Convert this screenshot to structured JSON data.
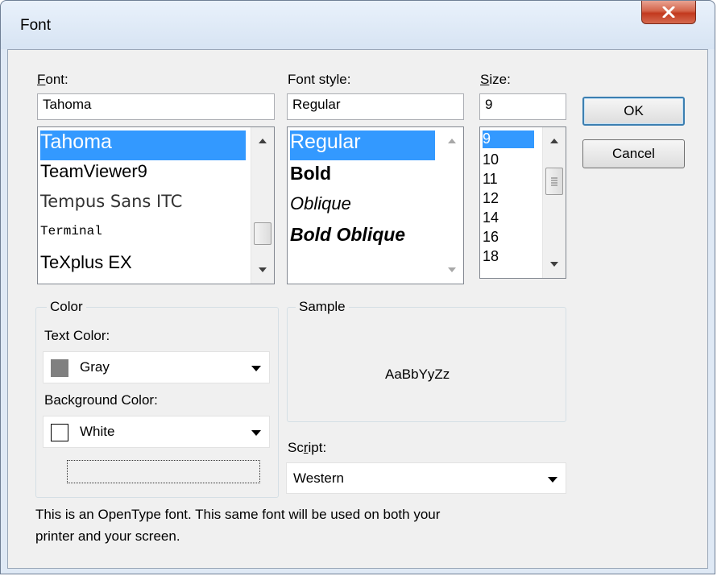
{
  "window": {
    "title": "Font",
    "close_glyph": "x"
  },
  "font": {
    "label_prefix": "F",
    "label_rest": "ont:",
    "value": "Tahoma",
    "items": [
      "Tahoma",
      "TeamViewer9",
      "Tempus Sans ITC",
      "Terminal",
      "TeXplus EX"
    ],
    "selected": "Tahoma"
  },
  "font_style": {
    "label": "Font style:",
    "value": "Regular",
    "items": [
      "Regular",
      "Bold",
      "Oblique",
      "Bold Oblique"
    ],
    "selected": "Regular"
  },
  "size": {
    "label_prefix": "S",
    "label_rest": "ize:",
    "value": "9",
    "items": [
      "9",
      "10",
      "11",
      "12",
      "14",
      "16",
      "18"
    ],
    "selected": "9"
  },
  "buttons": {
    "ok": "OK",
    "cancel": "Cancel"
  },
  "color_group": {
    "title": "Color",
    "text_color_label": "Text Color:",
    "text_color_value": "Gray",
    "text_color_swatch": "#808080",
    "bg_color_label": "Background Color:",
    "bg_color_value": "White",
    "bg_color_swatch": "#ffffff"
  },
  "sample": {
    "title": "Sample",
    "text": "AaBbYyZz"
  },
  "script": {
    "label_prefix": "Sc",
    "label_u": "r",
    "label_rest": "ipt:",
    "value": "Western"
  },
  "description": {
    "line1": "This is an OpenType font. This same font will be used on both your",
    "line2": "printer and your screen."
  },
  "icons": {
    "close": "close-icon",
    "scroll_up": "chevron-up-icon",
    "scroll_down": "chevron-down-icon",
    "dropdown": "dropdown-arrow-icon"
  },
  "colors": {
    "selection": "#3399ff",
    "close_button": "#c2391e",
    "default_button_border": "#3c7fb1"
  }
}
